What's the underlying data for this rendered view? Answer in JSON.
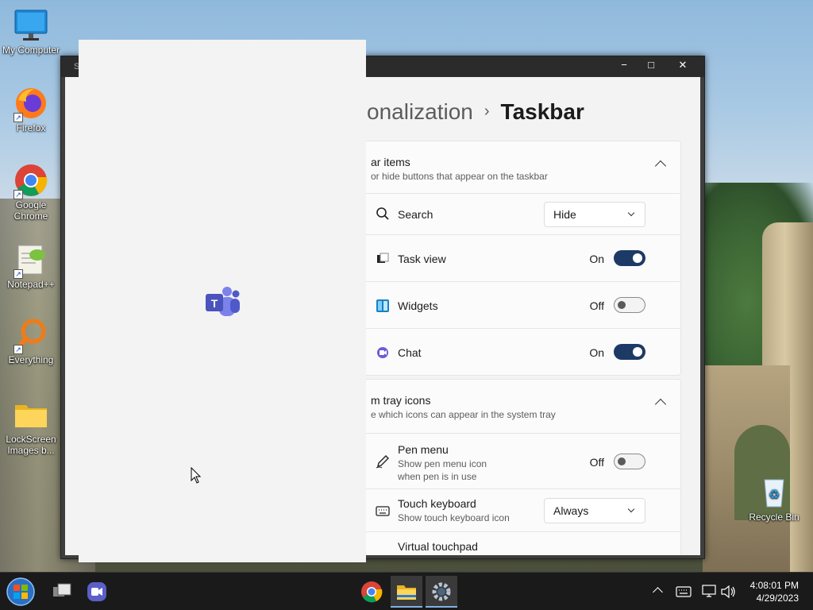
{
  "desktop": {
    "icons": [
      {
        "label": "My Computer"
      },
      {
        "label": "Firefox"
      },
      {
        "label": "Google Chrome"
      },
      {
        "label": "Notepad++"
      },
      {
        "label": "Everything"
      },
      {
        "label": "LockScreen Images b..."
      },
      {
        "label": "Recycle Bin"
      }
    ]
  },
  "window": {
    "title": "S",
    "controls": {
      "minimize": "−",
      "maximize": "□",
      "close": "✕"
    }
  },
  "settings": {
    "breadcrumb": {
      "parent": "onalization",
      "separator": "›",
      "current": "Taskbar"
    },
    "taskbar_items": {
      "title": "ar items",
      "subtitle": "or hide buttons that appear on the taskbar",
      "rows": [
        {
          "label": "Search",
          "value": "Hide",
          "icon": "search-icon"
        },
        {
          "label": "Task view",
          "state": "On",
          "icon": "task-view-icon"
        },
        {
          "label": "Widgets",
          "state": "Off",
          "icon": "widgets-icon"
        },
        {
          "label": "Chat",
          "state": "On",
          "icon": "chat-icon"
        }
      ]
    },
    "system_tray": {
      "title": "m tray icons",
      "subtitle": "e which icons can appear in the system tray",
      "rows": [
        {
          "label": "Pen menu",
          "sub1": "Show pen menu icon",
          "sub2": "when pen is in use",
          "state": "Off",
          "icon": "pen-icon"
        },
        {
          "label": "Touch keyboard",
          "sub1": "Show touch keyboard icon",
          "value": "Always",
          "icon": "keyboard-icon"
        },
        {
          "label": "Virtual touchpad",
          "icon": "touchpad-icon"
        }
      ]
    }
  },
  "taskbar": {
    "clock": {
      "time": "4:08:01 PM",
      "date": "4/29/2023"
    }
  },
  "colors": {
    "toggle_on": "#1d3a66",
    "accent": "#7fb1e6"
  }
}
